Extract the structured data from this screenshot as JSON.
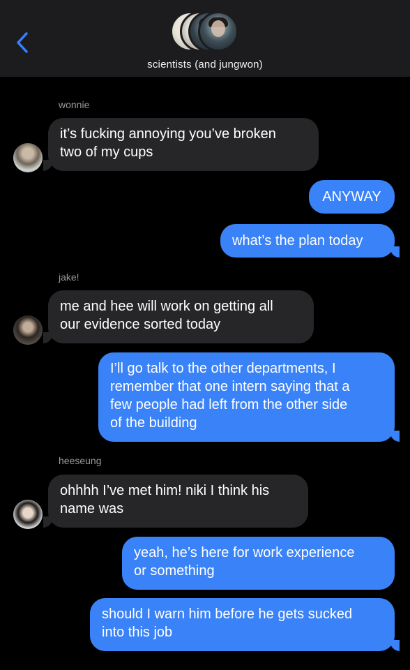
{
  "header": {
    "title": "scientists (and jungwon)",
    "colors": {
      "background": "#1c1c1e",
      "accent": "#3a82f7"
    },
    "back_icon": "chevron-left-icon"
  },
  "messages": [
    {
      "sender_label": "wonnie",
      "text": "it’s fucking annoying you’ve broken\ntwo of my cups",
      "direction": "incoming"
    },
    {
      "text": "ANYWAY",
      "direction": "outgoing"
    },
    {
      "text": "what’s the plan today",
      "direction": "outgoing"
    },
    {
      "sender_label": "jake!",
      "text": "me and hee will work on getting all\nour evidence sorted today",
      "direction": "incoming"
    },
    {
      "text": "I’ll go talk to the other departments, I\nremember that one intern saying that a\nfew people had left from the other side\nof the building",
      "direction": "outgoing"
    },
    {
      "sender_label": "heeseung",
      "text": "ohhhh I’ve met him! niki I think his\nname was",
      "direction": "incoming"
    },
    {
      "text": "yeah, he’s here for work experience\nor something",
      "direction": "outgoing"
    },
    {
      "text": "should I warn him before he gets sucked\ninto this job",
      "direction": "outgoing"
    }
  ]
}
